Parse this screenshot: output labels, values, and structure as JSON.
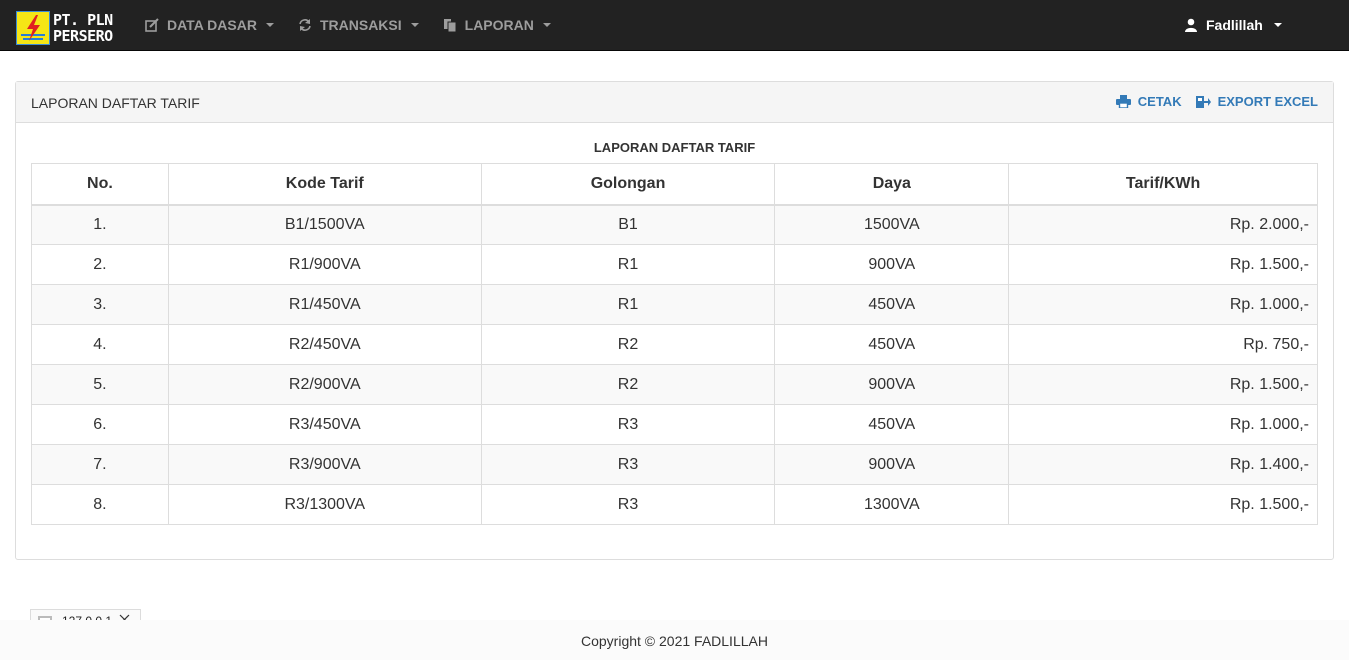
{
  "brand": {
    "line1": "PT. PLN",
    "line2": "PERSERO",
    "logo_icon": "pln-lightning-logo"
  },
  "nav": {
    "items": [
      {
        "label": "DATA DASAR",
        "icon": "edit-icon"
      },
      {
        "label": "TRANSAKSI",
        "icon": "refresh-icon"
      },
      {
        "label": "LAPORAN",
        "icon": "documents-icon"
      }
    ],
    "user": {
      "label": "Fadlillah",
      "icon": "user-icon"
    }
  },
  "panel": {
    "title": "LAPORAN DAFTAR TARIF",
    "actions": {
      "print": "CETAK",
      "export": "EXPORT EXCEL"
    }
  },
  "report": {
    "title": "LAPORAN DAFTAR TARIF",
    "columns": [
      "No.",
      "Kode Tarif",
      "Golongan",
      "Daya",
      "Tarif/KWh"
    ],
    "rows": [
      [
        "1.",
        "B1/1500VA",
        "B1",
        "1500VA",
        "Rp. 2.000,-"
      ],
      [
        "2.",
        "R1/900VA",
        "R1",
        "900VA",
        "Rp. 1.500,-"
      ],
      [
        "3.",
        "R1/450VA",
        "R1",
        "450VA",
        "Rp. 1.000,-"
      ],
      [
        "4.",
        "R2/450VA",
        "R2",
        "450VA",
        "Rp. 750,-"
      ],
      [
        "5.",
        "R2/900VA",
        "R2",
        "900VA",
        "Rp. 1.500,-"
      ],
      [
        "6.",
        "R3/450VA",
        "R3",
        "450VA",
        "Rp. 1.000,-"
      ],
      [
        "7.",
        "R3/900VA",
        "R3",
        "900VA",
        "Rp. 1.400,-"
      ],
      [
        "8.",
        "R3/1300VA",
        "R3",
        "1300VA",
        "Rp. 1.500,-"
      ]
    ]
  },
  "host_chip": {
    "label": "127.0.0.1"
  },
  "footer": {
    "text": "Copyright © 2021 FADLILLAH"
  },
  "colors": {
    "navbar": "#222222",
    "link": "#337ab7",
    "logo_yellow": "#f5e616"
  }
}
